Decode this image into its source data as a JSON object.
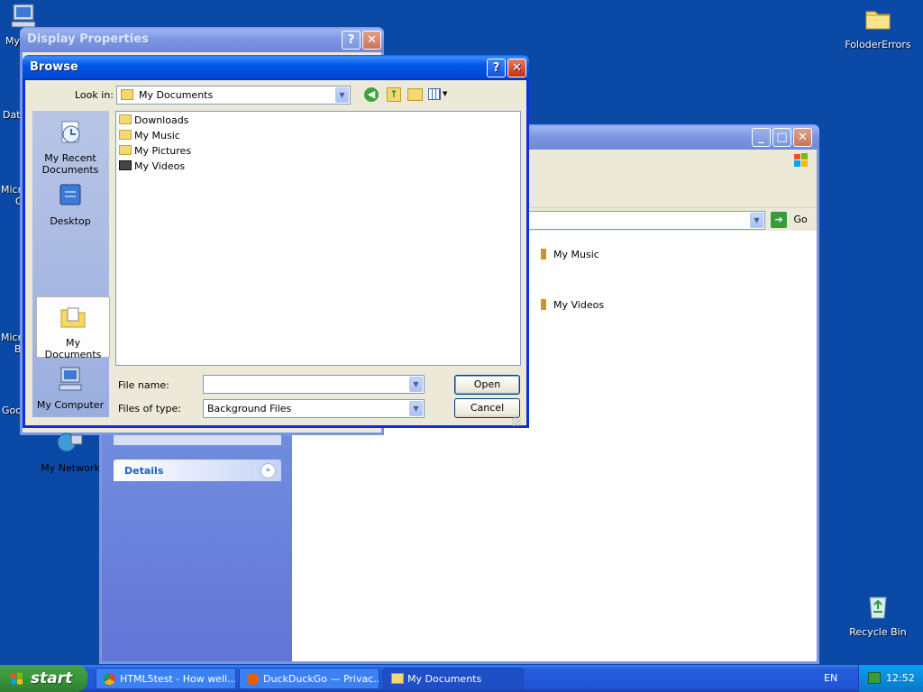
{
  "desktop": {
    "icons": [
      {
        "label": "My",
        "id": "my-computer"
      },
      {
        "label": "FoloderErrors",
        "id": "folder"
      },
      {
        "label": "Recycle Bin",
        "id": "recycle-bin"
      }
    ],
    "fragments": [
      "Dat",
      "Micro",
      "O",
      "Micro",
      "B",
      "Goo"
    ]
  },
  "display_properties": {
    "title": "Display Properties"
  },
  "explorer": {
    "address_go": "Go",
    "items": [
      "My Music",
      "My Videos"
    ],
    "details_label": "Details"
  },
  "browse": {
    "title": "Browse",
    "look_in_label": "Look in:",
    "look_in_value": "My Documents",
    "places": [
      "My Recent Documents",
      "Desktop",
      "My Documents",
      "My Computer",
      "My Network"
    ],
    "files": [
      "Downloads",
      "My Music",
      "My Pictures",
      "My Videos"
    ],
    "file_name_label": "File name:",
    "file_name_value": "",
    "file_type_label": "Files of type:",
    "file_type_value": "Background Files",
    "open_label": "Open",
    "cancel_label": "Cancel"
  },
  "taskbar": {
    "start_label": "start",
    "tasks": [
      "HTML5test - How well...",
      "DuckDuckGo — Privac...",
      "My Documents"
    ],
    "language": "EN",
    "clock": "12:52"
  },
  "colors": {
    "desktop": "#0a4aa6",
    "title_active": "#0058e6",
    "dialog_face": "#ece9d8",
    "taskbar": "#245edb"
  }
}
